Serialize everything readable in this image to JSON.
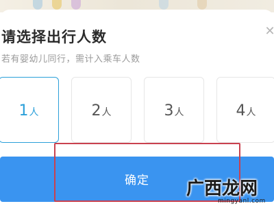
{
  "dialog": {
    "title": "请选择出行人数",
    "subtitle": "若有婴幼儿同行，需计入乘车人数",
    "close_icon": "close-icon",
    "options": [
      {
        "num": "1",
        "unit": "人",
        "selected": true
      },
      {
        "num": "2",
        "unit": "人",
        "selected": false
      },
      {
        "num": "3",
        "unit": "人",
        "selected": false
      },
      {
        "num": "4",
        "unit": "人",
        "selected": false
      }
    ],
    "confirm_label": "确定"
  },
  "colors": {
    "accent": "#2a9fd9",
    "button": "#3a94f0",
    "highlight": "#c9414e"
  },
  "watermark": {
    "text": "广西龙网",
    "url_text": "mingyanl.com"
  }
}
